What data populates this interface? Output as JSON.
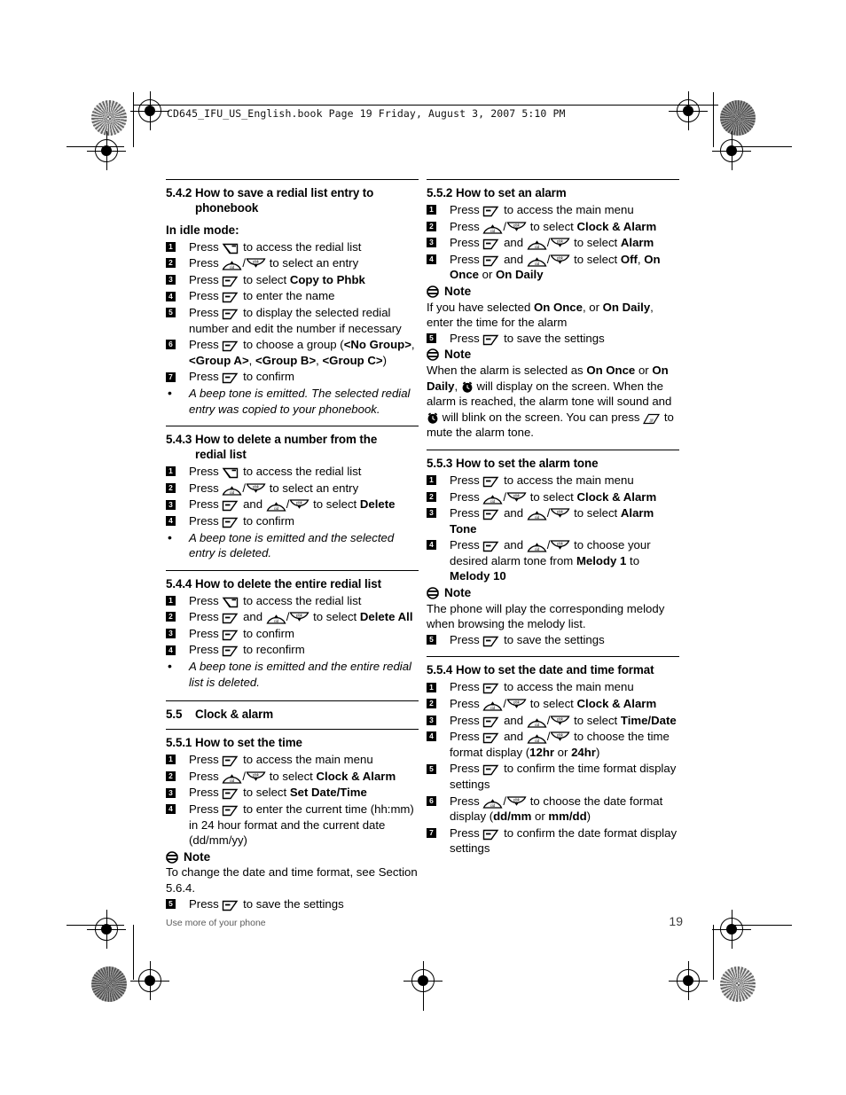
{
  "book_header": "CD645_IFU_US_English.book  Page 19  Friday, August 3, 2007  5:10 PM",
  "footer": {
    "left": "Use more of your phone",
    "page_number": "19"
  },
  "left_column": {
    "s542": {
      "number": "5.4.2",
      "title_line1": "How to save a redial list entry to",
      "title_line2": "phonebook",
      "idle_label": "In idle mode:",
      "steps": [
        {
          "n": "1",
          "pre": "Press",
          "key": "redial",
          "post": "to access the redial list"
        },
        {
          "n": "2",
          "pre": "Press",
          "key": "updown",
          "post": "to select an entry"
        },
        {
          "n": "3",
          "pre": "Press",
          "key": "soft",
          "post": "to select ",
          "bold": "Copy to Phbk"
        },
        {
          "n": "4",
          "pre": "Press",
          "key": "soft",
          "post": "to enter the name"
        },
        {
          "n": "5",
          "pre": "Press",
          "key": "soft",
          "post": "to display the selected redial number and edit the number if necessary"
        },
        {
          "n": "6",
          "pre": "Press",
          "key": "soft",
          "post": "to choose a group (",
          "groups": [
            "<No Group>",
            "<Group A>",
            "<Group B>",
            "<Group C>"
          ],
          "tail": ")"
        },
        {
          "n": "7",
          "pre": "Press",
          "key": "soft",
          "post": "to confirm"
        }
      ],
      "bullet": "A beep tone is emitted. The selected redial entry was copied to your phonebook."
    },
    "s543": {
      "number": "5.4.3",
      "title_line1": "How to delete a number from the",
      "title_line2": "redial list",
      "steps": [
        {
          "n": "1",
          "pre": "Press",
          "key": "redial",
          "post": "to access the redial list"
        },
        {
          "n": "2",
          "pre": "Press",
          "key": "updown",
          "post": "to select an entry"
        },
        {
          "n": "3",
          "pre": "Press",
          "key": "soft",
          "mid": "and",
          "key2": "updown",
          "post": "to select ",
          "bold": "Delete"
        },
        {
          "n": "4",
          "pre": "Press",
          "key": "soft",
          "post": "to confirm"
        }
      ],
      "bullet": "A beep tone is emitted and the selected entry is deleted."
    },
    "s544": {
      "number": "5.4.4",
      "title_line1": "How to delete the entire redial list",
      "steps": [
        {
          "n": "1",
          "pre": "Press",
          "key": "redial",
          "post": "to access the redial list"
        },
        {
          "n": "2",
          "pre": "Press",
          "key": "soft",
          "mid": "and",
          "key2": "updown",
          "post": "to select ",
          "bold": "Delete All"
        },
        {
          "n": "3",
          "pre": "Press",
          "key": "soft",
          "post": "to confirm"
        },
        {
          "n": "4",
          "pre": "Press",
          "key": "soft",
          "post": "to reconfirm"
        }
      ],
      "bullet": "A beep tone is emitted and the entire redial list is deleted."
    },
    "s55": {
      "number": "5.5",
      "title": "Clock & alarm"
    },
    "s551": {
      "number": "5.5.1",
      "title_line1": "How to set the time",
      "steps": [
        {
          "n": "1",
          "pre": "Press",
          "key": "soft",
          "post": "to access the main menu"
        },
        {
          "n": "2",
          "pre": "Press",
          "key": "updown",
          "post": "to select ",
          "bold": "Clock & Alarm"
        },
        {
          "n": "3",
          "pre": "Press",
          "key": "soft",
          "post": "to select ",
          "bold": "Set Date/Time"
        },
        {
          "n": "4",
          "pre": "Press",
          "key": "soft",
          "post": "to enter the current time (hh:mm) in 24 hour format and the current date (dd/mm/yy)"
        }
      ],
      "note_label": "Note",
      "note_body": "To change the date and time format, see Section 5.6.4.",
      "steps_after": [
        {
          "n": "5",
          "pre": "Press",
          "key": "soft",
          "post": "to save the settings"
        }
      ]
    }
  },
  "right_column": {
    "s552": {
      "number": "5.5.2",
      "title_line1": "How to set an alarm",
      "steps": [
        {
          "n": "1",
          "pre": "Press",
          "key": "soft",
          "post": "to access the main menu"
        },
        {
          "n": "2",
          "pre": "Press",
          "key": "updown",
          "post": "to select ",
          "bold": "Clock & Alarm"
        },
        {
          "n": "3",
          "pre": "Press",
          "key": "soft",
          "mid": "and",
          "key2": "updown",
          "post": "to select ",
          "bold": "Alarm"
        },
        {
          "n": "4",
          "pre": "Press",
          "key": "soft",
          "mid": "and",
          "key2": "updown",
          "post": "to select ",
          "bold_multi": [
            "Off",
            "On Once",
            "On Daily"
          ],
          "tail": " or "
        }
      ],
      "note1_label": "Note",
      "note1_body_pre": "If you have selected ",
      "note1_b1": "On Once",
      "note1_mid": ", or ",
      "note1_b2": "On Daily",
      "note1_post": ", enter the time for the alarm",
      "steps_after": [
        {
          "n": "5",
          "pre": "Press",
          "key": "soft",
          "post": "to save the settings"
        }
      ],
      "note2_label": "Note",
      "note2_line1_pre": "When the alarm is selected as ",
      "note2_b1": "On Once",
      "note2_mid1": " or ",
      "note2_b2": "On Daily",
      "note2_mid2": ", ",
      "note2_post1": " will display on the screen.",
      "note2_line2": "When the alarm is reached, the alarm tone will sound and",
      "note2_line3": "will blink on the screen. You can press",
      "note2_line4": "to mute the alarm tone."
    },
    "s553": {
      "number": "5.5.3",
      "title_line1": "How to set the alarm tone",
      "steps": [
        {
          "n": "1",
          "pre": "Press",
          "key": "soft",
          "post": "to access the main menu"
        },
        {
          "n": "2",
          "pre": "Press",
          "key": "updown",
          "post": "to select ",
          "bold": "Clock & Alarm"
        },
        {
          "n": "3",
          "pre": "Press",
          "key": "soft",
          "mid": "and",
          "key2": "updown",
          "post": "to select ",
          "bold": "Alarm Tone"
        },
        {
          "n": "4",
          "pre": "Press",
          "key": "soft",
          "mid": "and",
          "key2": "updown",
          "post": "to choose your desired alarm tone from ",
          "bold": "Melody 1",
          "mid2": " to ",
          "bold2": "Melody 10"
        }
      ],
      "note_label": "Note",
      "note_body": "The phone will play the corresponding melody when browsing the melody list.",
      "steps_after": [
        {
          "n": "5",
          "pre": "Press",
          "key": "soft",
          "post": "to save the settings"
        }
      ]
    },
    "s554": {
      "number": "5.5.4",
      "title_line1": "How to set the date and time format",
      "steps": [
        {
          "n": "1",
          "pre": "Press",
          "key": "soft",
          "post": "to access the main menu"
        },
        {
          "n": "2",
          "pre": "Press",
          "key": "updown",
          "post": "to select ",
          "bold": "Clock & Alarm"
        },
        {
          "n": "3",
          "pre": "Press",
          "key": "soft",
          "mid": "and",
          "key2": "updown",
          "post": "to select ",
          "bold": "Time/Date"
        },
        {
          "n": "4",
          "pre": "Press",
          "key": "soft",
          "mid": "and",
          "key2": "updown",
          "post": "to choose the time format display (",
          "bold": "12hr",
          "mid2": " or ",
          "bold2": "24hr",
          "tail": ")"
        },
        {
          "n": "5",
          "pre": "Press",
          "key": "soft",
          "post": "to confirm the time format display settings"
        },
        {
          "n": "6",
          "pre": "Press",
          "key": "updown",
          "post": "to choose the date format display (",
          "bold": "dd/mm",
          "mid2": " or ",
          "bold2": "mm/dd",
          "tail": ")"
        },
        {
          "n": "7",
          "pre": "Press",
          "key": "soft",
          "post": "to confirm the date format display settings"
        }
      ]
    }
  },
  "key_icons": {
    "soft": "soft-key-icon",
    "redial": "redial-key-icon",
    "up": "up-cid-key-icon",
    "down": "down-pbk-key-icon",
    "note": "note-icon",
    "alarm_clock": "alarm-clock-icon",
    "onoff": "on-off-key-icon"
  }
}
